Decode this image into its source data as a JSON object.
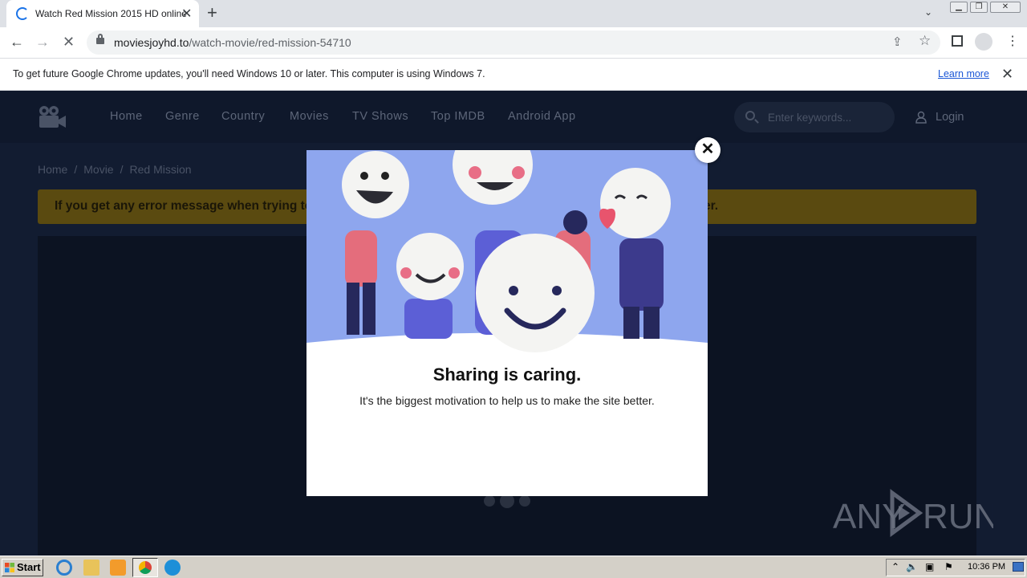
{
  "browser": {
    "tab_title": "Watch Red Mission 2015 HD online",
    "url_host": "moviesjoyhd.to",
    "url_path": "/watch-movie/red-mission-54710"
  },
  "infobar": {
    "text": "To get future Google Chrome updates, you'll need Windows 10 or later. This computer is using Windows 7.",
    "link": "Learn more"
  },
  "site": {
    "nav": [
      "Home",
      "Genre",
      "Country",
      "Movies",
      "TV Shows",
      "Top IMDB",
      "Android App"
    ],
    "search_placeholder": "Enter keywords...",
    "login": "Login",
    "breadcrumb": [
      "Home",
      "Movie",
      "Red Mission"
    ],
    "alert_text": "If you get any error message when trying to",
    "alert_tail": "er."
  },
  "modal": {
    "title": "Sharing is caring.",
    "subtitle": "It's the biggest motivation to help us to make the site better."
  },
  "taskbar": {
    "start": "Start",
    "clock": "10:36 PM"
  },
  "watermark": "ANY RUN"
}
